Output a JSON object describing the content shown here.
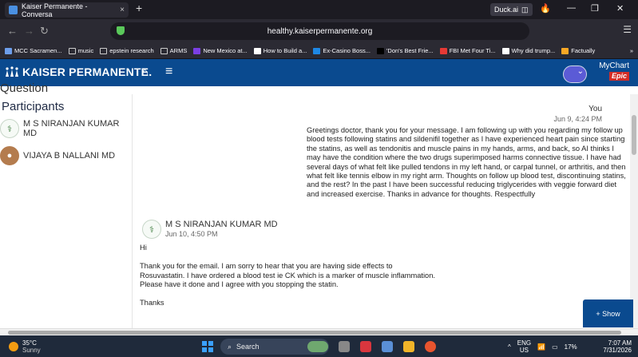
{
  "browser": {
    "tab_title": "Kaiser Permanente - Conversa",
    "tab_close": "×",
    "new_tab": "+",
    "duck_label": "Duck.ai",
    "url": "healthy.kaiserpermanente.org",
    "bookmarks": [
      {
        "label": "MCC Sacramen...",
        "color": "#6d9eeb"
      },
      {
        "label": "music",
        "color": ""
      },
      {
        "label": "epstein research",
        "color": ""
      },
      {
        "label": "ARMS",
        "color": ""
      },
      {
        "label": "New Mexico at...",
        "color": "#7b3fe4"
      },
      {
        "label": "How to Build a...",
        "color": "#ffffff"
      },
      {
        "label": "Ex-Casino Boss...",
        "color": "#1e88e5"
      },
      {
        "label": "'Don's Best Frie...",
        "color": "#000000"
      },
      {
        "label": "FBI Met Four Ti...",
        "color": "#e53935"
      },
      {
        "label": "Why did trump...",
        "color": "#ffffff"
      },
      {
        "label": "Factually",
        "color": "#f9a825"
      }
    ],
    "bookmark_overflow": "»"
  },
  "header": {
    "brand": "KAISER PERMANENTE.",
    "mychart_line1": "MyChart",
    "mychart_line2": "Epic",
    "brand_color": "#0a4a8f"
  },
  "page": {
    "partial_heading": "Question"
  },
  "sidebar": {
    "title": "Participants",
    "participants": [
      {
        "name": "M S NIRANJAN KUMAR MD",
        "icon": "stethoscope-icon"
      },
      {
        "name": "VIJAYA B NALLANI MD",
        "icon": "photo"
      }
    ]
  },
  "thread": {
    "msg1": {
      "sender": "You",
      "time": "Jun 9, 4:24 PM",
      "body": "Greetings doctor, thank you for your message. I am following up with you regarding my follow up blood tests following statins and sildenifil together as I have experienced heart pain since starting the statins, as well as tendonitis and muscle pains in my hands, arms, and back, so AI thinks I may have the condition where the two drugs superimposed harms connective tissue. I have had several days of what felt like pulled tendons in my left hand, or carpal tunnel, or arthritis, and then what felt like tennis elbow in my right arm. Thoughts on follow up blood test, discontinuing statins, and the rest? In the past I have been successful reducing triglycerides with veggie forward diet and increased exercise. Thanks in advance for thoughts. Respectfully"
    },
    "msg2": {
      "sender": "M S NIRANJAN KUMAR MD",
      "time": "Jun 10, 4:50 PM",
      "lines": [
        "Hi",
        "",
        "Thank you for the email. I am sorry to hear that you are having side effects to",
        "Rosuvastatin. I have ordered a blood test ie CK which is a marker of muscle inflammation.",
        "Please have it done and I agree with you stopping the statin.",
        "",
        "Thanks"
      ]
    }
  },
  "show_button": "+ Show",
  "taskbar": {
    "temp": "35°C",
    "weather": "Sunny",
    "search": "Search",
    "lang1": "ENG",
    "lang2": "US",
    "battery": "17%",
    "time": "7:07 AM",
    "date": "7/31/2026"
  }
}
